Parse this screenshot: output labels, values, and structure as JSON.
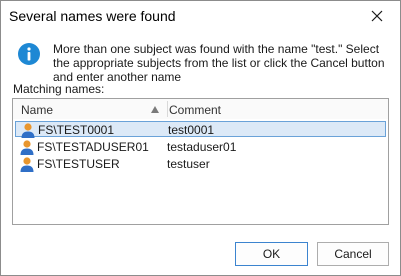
{
  "dialog": {
    "title": "Several names were found",
    "message": "More than one subject was found with the name \"test.\" Select the appropriate subjects from the list or click the Cancel button and enter another name",
    "matching_label": "Matching names:"
  },
  "list": {
    "columns": {
      "name": "Name",
      "comment": "Comment"
    },
    "sort": "name-ascending",
    "rows": [
      {
        "name": "FS\\TEST0001",
        "comment": "test0001",
        "selected": true,
        "icon": "user-icon"
      },
      {
        "name": "FS\\TESTADUSER01",
        "comment": "testaduser01",
        "selected": false,
        "icon": "user-icon"
      },
      {
        "name": "FS\\TESTUSER",
        "comment": "testuser",
        "selected": false,
        "icon": "user-icon"
      }
    ]
  },
  "buttons": {
    "ok": "OK",
    "cancel": "Cancel"
  },
  "icons": {
    "info": "info-icon",
    "close": "close-icon",
    "sort": "sort-up-icon"
  },
  "colors": {
    "info_blue": "#1e88d4",
    "selection_bg": "#dce9f7",
    "selection_border": "#6aa2d8",
    "user_head": "#e8962e",
    "user_body": "#2f6fc7",
    "ok_border": "#3c84cf"
  }
}
